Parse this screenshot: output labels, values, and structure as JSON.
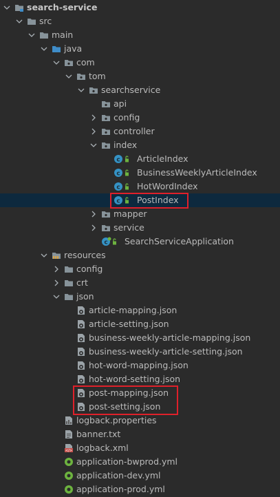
{
  "tree": [
    {
      "label": "search-service",
      "depth": 0,
      "expand": "open",
      "icon": "module-folder-icon",
      "bold": true
    },
    {
      "label": "src",
      "depth": 1,
      "expand": "open",
      "icon": "folder-icon"
    },
    {
      "label": "main",
      "depth": 2,
      "expand": "open",
      "icon": "folder-icon"
    },
    {
      "label": "java",
      "depth": 3,
      "expand": "open",
      "icon": "source-folder-icon"
    },
    {
      "label": "com",
      "depth": 4,
      "expand": "open",
      "icon": "package-icon"
    },
    {
      "label": "tom",
      "depth": 5,
      "expand": "open",
      "icon": "package-icon"
    },
    {
      "label": "searchservice",
      "depth": 6,
      "expand": "open",
      "icon": "package-icon"
    },
    {
      "label": "api",
      "depth": 7,
      "expand": "none",
      "icon": "package-icon"
    },
    {
      "label": "config",
      "depth": 7,
      "expand": "closed",
      "icon": "package-icon"
    },
    {
      "label": "controller",
      "depth": 7,
      "expand": "closed",
      "icon": "package-icon"
    },
    {
      "label": "index",
      "depth": 7,
      "expand": "open",
      "icon": "package-icon"
    },
    {
      "label": "ArticleIndex",
      "depth": 8,
      "expand": "none",
      "icon": "java-class-icon"
    },
    {
      "label": "BusinessWeeklyArticleIndex",
      "depth": 8,
      "expand": "none",
      "icon": "java-class-icon"
    },
    {
      "label": "HotWordIndex",
      "depth": 8,
      "expand": "none",
      "icon": "java-class-icon"
    },
    {
      "label": "PostIndex",
      "depth": 8,
      "expand": "none",
      "icon": "java-class-icon",
      "selected": true
    },
    {
      "label": "mapper",
      "depth": 7,
      "expand": "closed",
      "icon": "package-icon"
    },
    {
      "label": "service",
      "depth": 7,
      "expand": "closed",
      "icon": "package-icon"
    },
    {
      "label": "SearchServiceApplication",
      "depth": 7,
      "expand": "none",
      "icon": "spring-boot-app-icon"
    },
    {
      "label": "resources",
      "depth": 3,
      "expand": "open",
      "icon": "resources-folder-icon"
    },
    {
      "label": "config",
      "depth": 4,
      "expand": "closed",
      "icon": "folder-icon"
    },
    {
      "label": "crt",
      "depth": 4,
      "expand": "closed",
      "icon": "folder-icon"
    },
    {
      "label": "json",
      "depth": 4,
      "expand": "open",
      "icon": "folder-icon"
    },
    {
      "label": "article-mapping.json",
      "depth": 5,
      "expand": "none",
      "icon": "json-file-icon"
    },
    {
      "label": "article-setting.json",
      "depth": 5,
      "expand": "none",
      "icon": "json-file-icon"
    },
    {
      "label": "business-weekly-article-mapping.json",
      "depth": 5,
      "expand": "none",
      "icon": "json-file-icon"
    },
    {
      "label": "business-weekly-article-setting.json",
      "depth": 5,
      "expand": "none",
      "icon": "json-file-icon"
    },
    {
      "label": "hot-word-mapping.json",
      "depth": 5,
      "expand": "none",
      "icon": "json-file-icon"
    },
    {
      "label": "hot-word-setting.json",
      "depth": 5,
      "expand": "none",
      "icon": "json-file-icon"
    },
    {
      "label": "post-mapping.json",
      "depth": 5,
      "expand": "none",
      "icon": "json-file-icon"
    },
    {
      "label": "post-setting.json",
      "depth": 5,
      "expand": "none",
      "icon": "json-file-icon"
    },
    {
      "label": "logback.properties",
      "depth": 4,
      "expand": "none",
      "icon": "properties-file-icon"
    },
    {
      "label": "banner.txt",
      "depth": 4,
      "expand": "none",
      "icon": "text-file-icon"
    },
    {
      "label": "logback.xml",
      "depth": 4,
      "expand": "none",
      "icon": "xml-file-icon"
    },
    {
      "label": "application-bwprod.yml",
      "depth": 4,
      "expand": "none",
      "icon": "yaml-file-icon"
    },
    {
      "label": "application-dev.yml",
      "depth": 4,
      "expand": "none",
      "icon": "yaml-file-icon"
    },
    {
      "label": "application-prod.yml",
      "depth": 4,
      "expand": "none",
      "icon": "yaml-file-icon"
    }
  ],
  "highlights": [
    {
      "name": "highlight-box-postindex",
      "from": "PostIndex",
      "to": "PostIndex"
    },
    {
      "name": "highlight-box-post-json",
      "from": "post-mapping.json",
      "to": "post-setting.json"
    }
  ],
  "colors": {
    "background": "#2b2b2b",
    "selection": "#0d293e",
    "text": "#bbbbbb",
    "highlight": "#e0202a",
    "folder": "#87939a",
    "source_folder": "#3f8dc9",
    "java_class": "#3592c4",
    "spring": "#6db33f"
  }
}
